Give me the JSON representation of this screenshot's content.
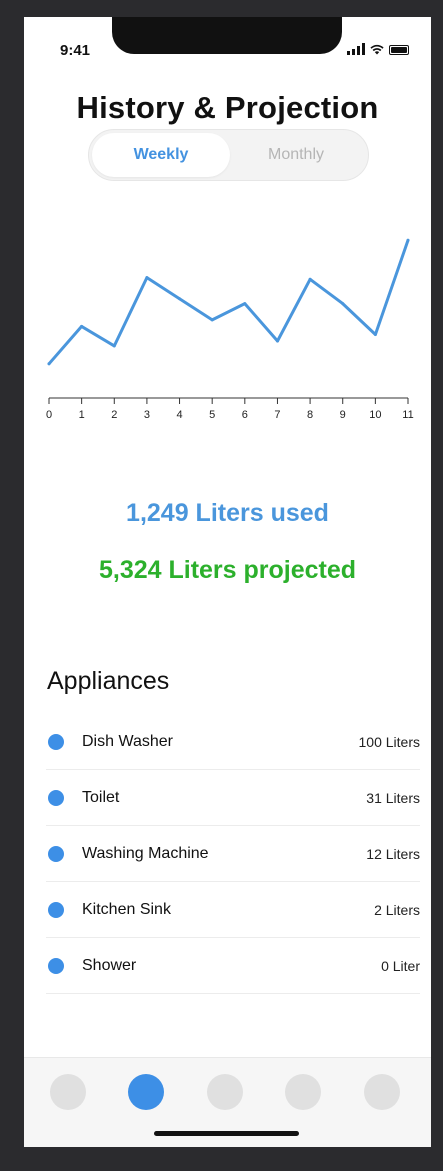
{
  "status_bar": {
    "time": "9:41"
  },
  "header": {
    "title": "History & Projection"
  },
  "segment": {
    "weekly": "Weekly",
    "monthly": "Monthly",
    "selected": "Weekly"
  },
  "chart_data": {
    "type": "line",
    "x": [
      0,
      1,
      2,
      3,
      4,
      5,
      6,
      7,
      8,
      9,
      10,
      11
    ],
    "series": [
      {
        "values": [
          2,
          25,
          13,
          55,
          42,
          29,
          39,
          16,
          54,
          39,
          20,
          78
        ]
      }
    ],
    "tick_labels": [
      "0",
      "1",
      "2",
      "3",
      "4",
      "5",
      "6",
      "7",
      "8",
      "9",
      "10",
      "11"
    ],
    "color": "#4a96dc",
    "ylim": [
      0,
      80
    ],
    "grid": false
  },
  "summary": {
    "used": "1,249 Liters used",
    "projected": "5,324 Liters projected"
  },
  "appliances": {
    "heading": "Appliances",
    "items": [
      {
        "name": "Dish Washer",
        "amount": "100 Liters"
      },
      {
        "name": "Toilet",
        "amount": "31 Liters"
      },
      {
        "name": "Washing Machine",
        "amount": "12 Liters"
      },
      {
        "name": "Kitchen Sink",
        "amount": "2 Liters"
      },
      {
        "name": "Shower",
        "amount": "0 Liter"
      }
    ]
  },
  "tab_bar": {
    "tab_count": 5,
    "active_index": 1
  },
  "colors": {
    "accent": "#3d8fe6",
    "used": "#4a96dc",
    "projected": "#2cb02c"
  }
}
